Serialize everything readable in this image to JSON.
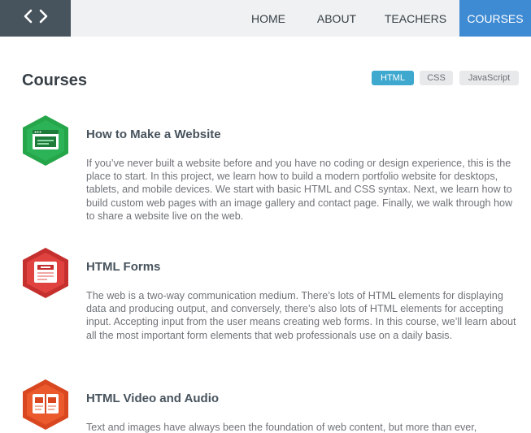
{
  "header": {
    "logo_icon": "code-brackets-icon",
    "nav": {
      "home": "HOME",
      "about": "ABOUT",
      "teachers": "TEACHERS",
      "courses": "COURSES"
    },
    "active_color": "#3f8bd3"
  },
  "page": {
    "title": "Courses"
  },
  "filters": {
    "html": "HTML",
    "css": "CSS",
    "javascript": "JavaScript",
    "active": "HTML",
    "active_color": "#3fa8cf"
  },
  "courses": [
    {
      "title": "How to Make a Website",
      "icon": "browser-window-icon",
      "color": "#26a64a",
      "description": "If you’ve never built a website before and you have no coding or design experience, this is the place to start. In this project, we learn how to build a modern portfolio website for desktops, tablets, and mobile devices. We start with basic HTML and CSS syntax. Next, we learn how to build custom web pages with an image gallery and contact page. Finally, we walk through how to share a website live on the web."
    },
    {
      "title": "HTML Forms",
      "icon": "form-icon",
      "color": "#e0433f",
      "description": "The web is a two-way communication medium. There’s lots of HTML elements for displaying data and producing output, and conversely, there’s also lots of HTML elements for accepting input. Accepting input from the user means creating web forms. In this course, we’ll learn about all the most important form elements that web professionals use on a daily basis."
    },
    {
      "title": "HTML Video and Audio",
      "icon": "media-player-icon",
      "color": "#ea5a2c",
      "description": "Text and images have always been the foundation of web content, but more than ever,"
    }
  ]
}
